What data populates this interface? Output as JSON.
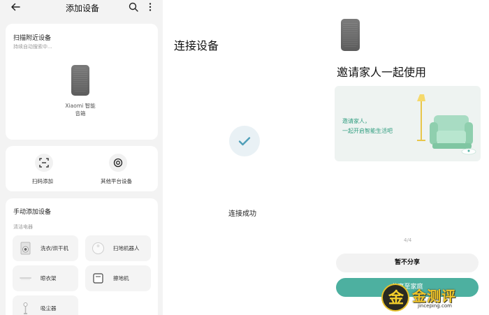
{
  "left_screen": {
    "title": "添加设备",
    "icons": {
      "back": "arrow-left-icon",
      "search": "search-icon",
      "more": "more-vertical-icon"
    },
    "scan_card": {
      "heading": "扫描附近设备",
      "status": "持续自动搜索中...",
      "device_line1": "Xiaomi 智能",
      "device_line2": "音箱"
    },
    "quick_actions": [
      {
        "label": "扫码添加",
        "icon": "scan-icon"
      },
      {
        "label": "其他平台设备",
        "icon": "target-icon"
      }
    ],
    "manual": {
      "heading": "手动添加设备",
      "category": "清洁电器",
      "items": [
        {
          "label": "洗衣/烘干机",
          "icon": "washing-machine-icon"
        },
        {
          "label": "扫地机器人",
          "icon": "robot-vacuum-icon"
        },
        {
          "label": "晾衣架",
          "icon": "drying-rack-icon"
        },
        {
          "label": "擦地机",
          "icon": "floor-scrubber-icon"
        },
        {
          "label": "吸尘器",
          "icon": "vacuum-cleaner-icon"
        }
      ]
    }
  },
  "middle_screen": {
    "heading": "连接设备",
    "status": "连接成功",
    "icon": "check-icon",
    "accent": "#4f9fb8"
  },
  "right_screen": {
    "heading": "邀请家人一起使用",
    "banner_line1": "邀请家人，",
    "banner_line2": "一起开启智能生活吧",
    "page_indicator": "4/4",
    "skip_button": "暂不分享",
    "share_button": "分享至家庭",
    "accent": "#4db0a0"
  },
  "watermark": {
    "glyph": "金",
    "name": "金测评",
    "url": "jinceping.com"
  }
}
